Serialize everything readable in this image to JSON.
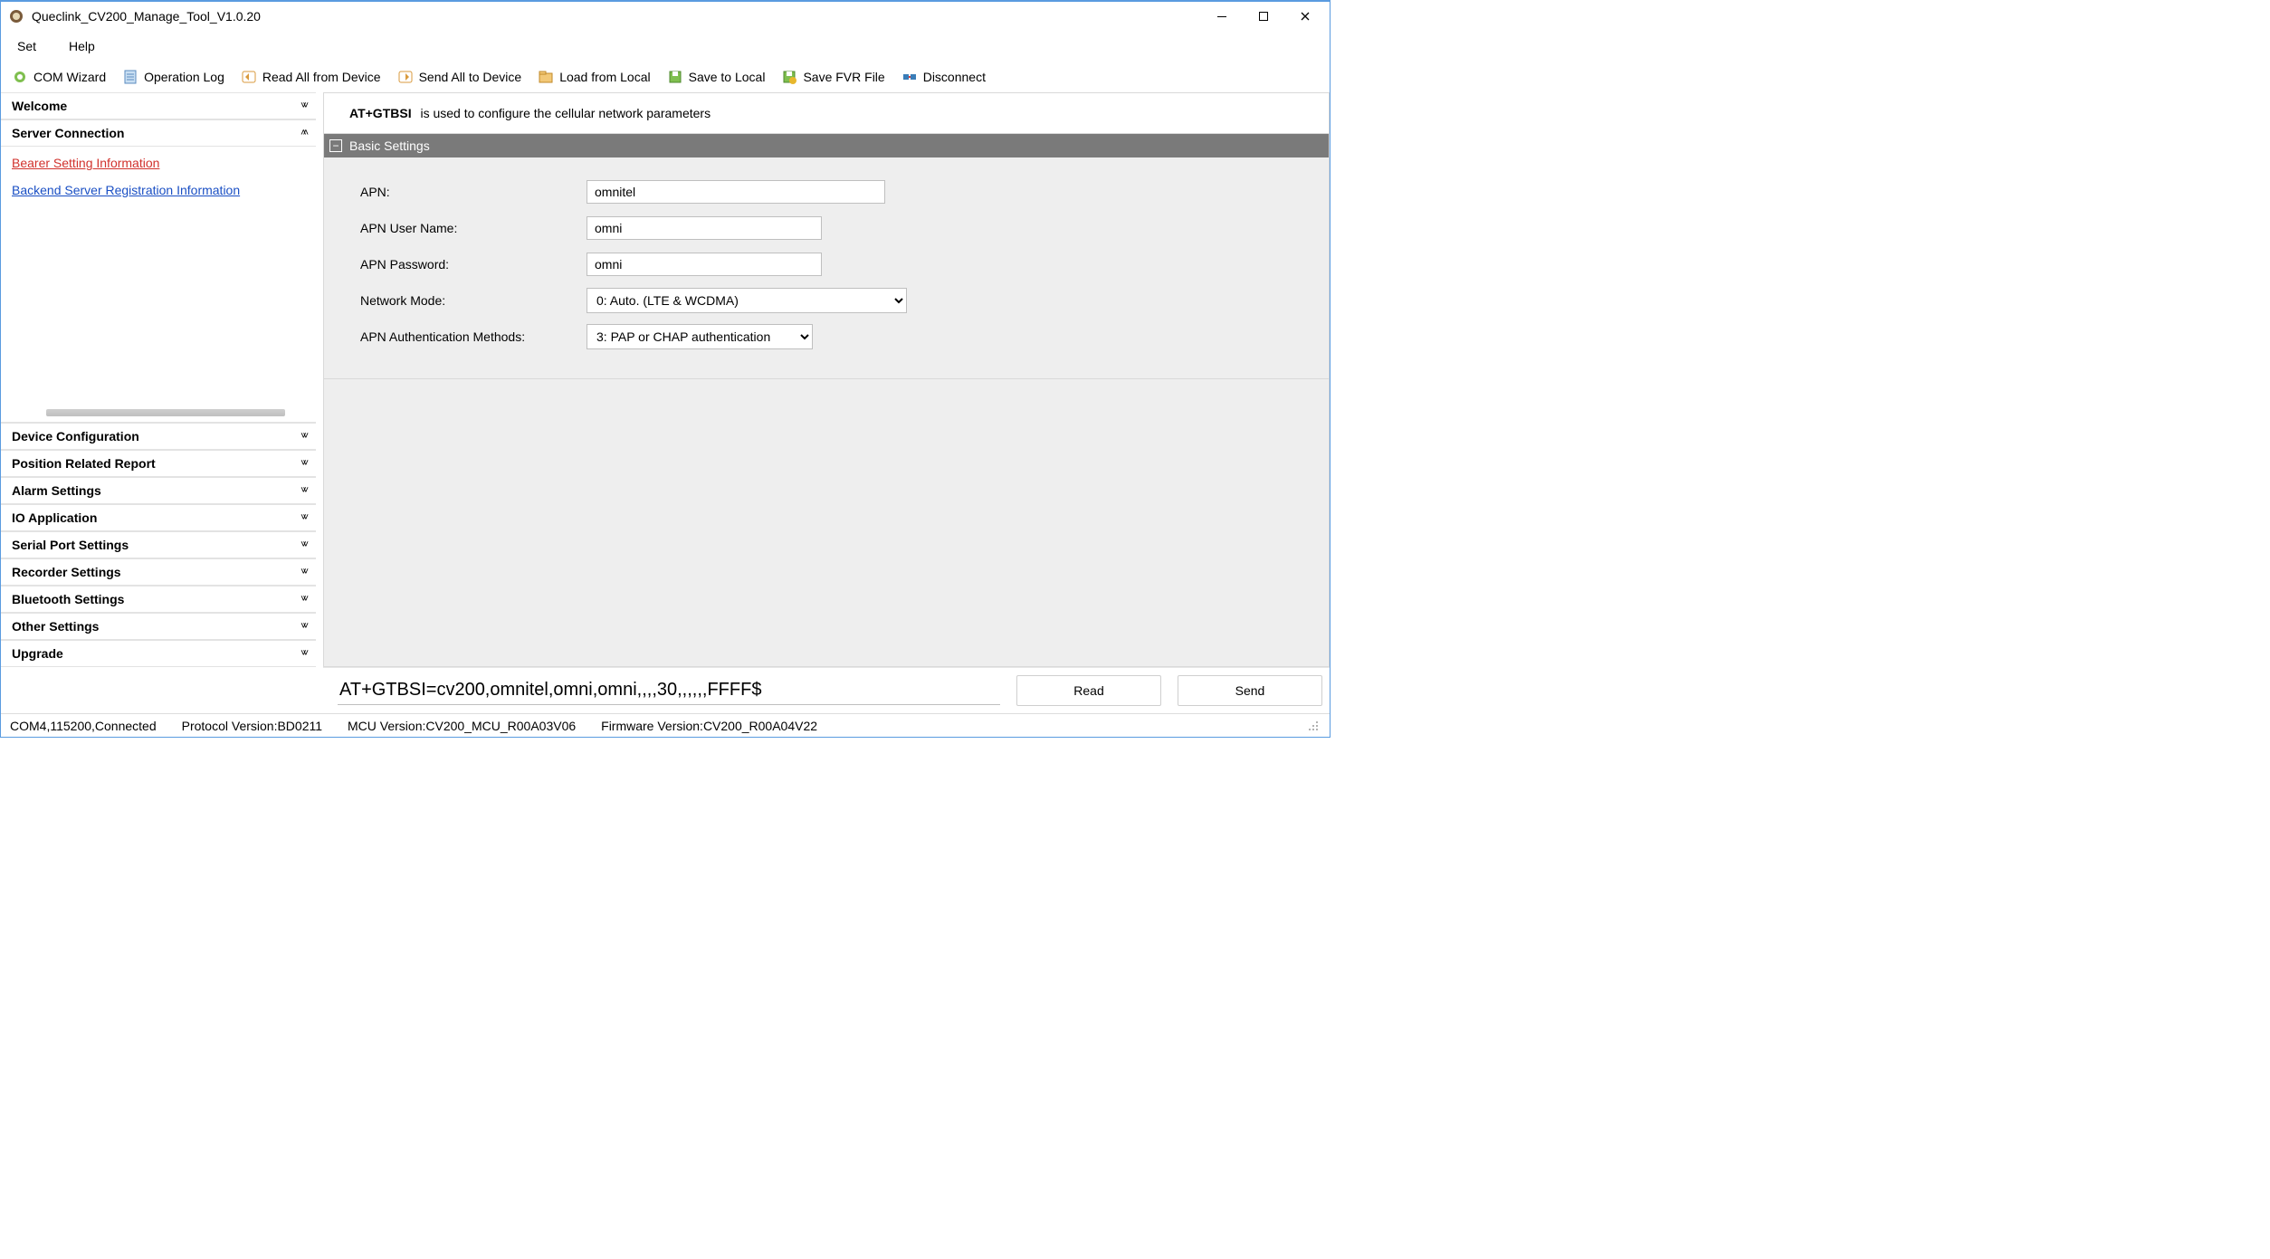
{
  "title": "Queclink_CV200_Manage_Tool_V1.0.20",
  "menubar": {
    "set": "Set",
    "help": "Help"
  },
  "toolbar": {
    "com_wizard": "COM Wizard",
    "operation_log": "Operation Log",
    "read_all": "Read All from Device",
    "send_all": "Send All to Device",
    "load_local": "Load from Local",
    "save_local": "Save to Local",
    "save_fvr": "Save FVR File",
    "disconnect": "Disconnect"
  },
  "sidebar": {
    "sections": {
      "welcome": "Welcome",
      "server_connection": "Server Connection",
      "device_configuration": "Device Configuration",
      "position_related_report": "Position Related Report",
      "alarm_settings": "Alarm Settings",
      "io_application": "IO Application",
      "serial_port_settings": "Serial Port Settings",
      "recorder_settings": "Recorder Settings",
      "bluetooth_settings": "Bluetooth Settings",
      "other_settings": "Other Settings",
      "upgrade": "Upgrade"
    },
    "links": {
      "bearer": "Bearer Setting Information",
      "backend": "Backend Server Registration Information"
    }
  },
  "main": {
    "cmd_label": "AT+GTBSI",
    "cmd_desc": " is used to configure the cellular network parameters",
    "group_title": "Basic Settings",
    "form": {
      "apn_label": "APN:",
      "apn_value": "omnitel",
      "apn_user_label": "APN User Name:",
      "apn_user_value": "omni",
      "apn_pass_label": "APN Password:",
      "apn_pass_value": "omni",
      "network_mode_label": "Network Mode:",
      "network_mode_value": "0: Auto. (LTE & WCDMA)",
      "auth_label": "APN Authentication Methods:",
      "auth_value": "3: PAP or CHAP authentication"
    },
    "command_string": "AT+GTBSI=cv200,omnitel,omni,omni,,,,30,,,,,,FFFF$",
    "read_btn": "Read",
    "send_btn": "Send"
  },
  "statusbar": {
    "conn": "COM4,115200,Connected",
    "protocol": "Protocol Version:BD0211",
    "mcu": "MCU Version:CV200_MCU_R00A03V06",
    "fw": "Firmware Version:CV200_R00A04V22"
  },
  "glyphs": {
    "down": "˅˅",
    "up": "˄˄",
    "minus": "−"
  }
}
